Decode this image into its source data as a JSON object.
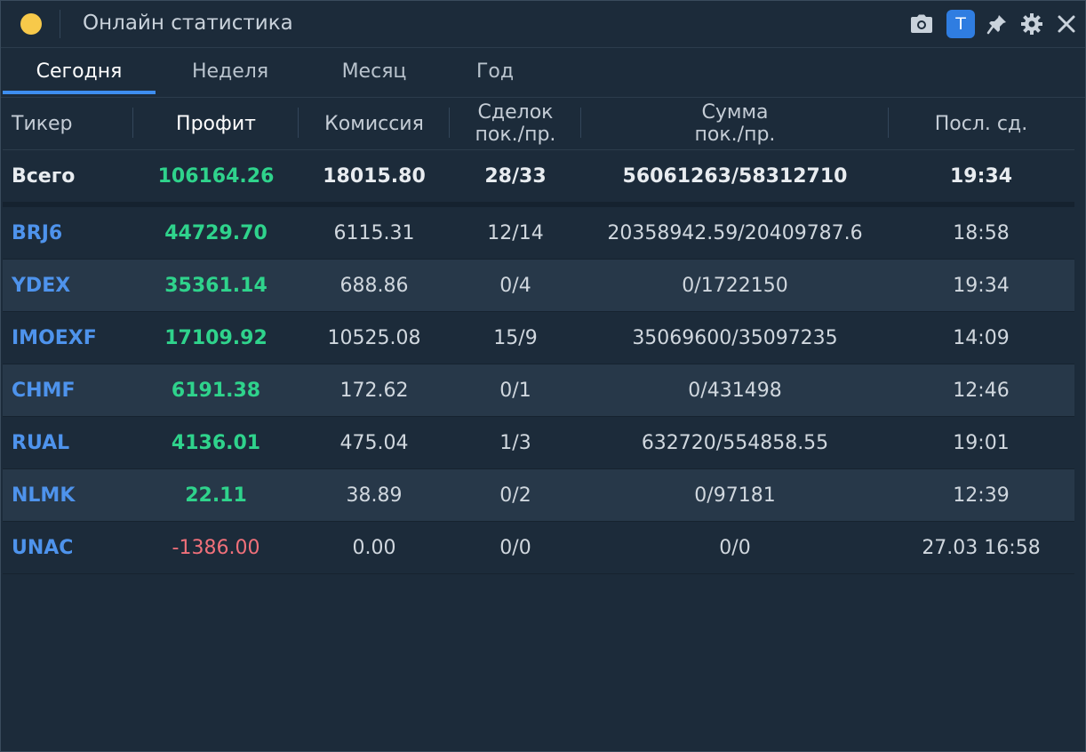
{
  "window": {
    "title": "Онлайн статистика",
    "theme_button_label": "T"
  },
  "colors": {
    "profit_positive": "#2fd38c",
    "profit_negative": "#f0707a",
    "ticker": "#4e93ec",
    "accent": "#3e8ef0",
    "status_dot": "#f7c94a"
  },
  "icons": [
    "camera-icon",
    "theme-toggle-icon",
    "pin-icon",
    "settings-gear-icon",
    "close-icon"
  ],
  "tabs": [
    {
      "label": "Сегодня",
      "active": true
    },
    {
      "label": "Неделя",
      "active": false
    },
    {
      "label": "Месяц",
      "active": false
    },
    {
      "label": "Год",
      "active": false
    }
  ],
  "table": {
    "headers": {
      "ticker": "Тикер",
      "profit": "Профит",
      "commission": "Комиссия",
      "deals_line1": "Сделок",
      "deals_line2": "пок./пр.",
      "sum_line1": "Сумма",
      "sum_line2": "пок./пр.",
      "last": "Посл. сд."
    },
    "total": {
      "label": "Всего",
      "profit": "106164.26",
      "commission": "18015.80",
      "deals": "28/33",
      "sum": "56061263/58312710",
      "last": "19:34"
    },
    "rows": [
      {
        "ticker": "BRJ6",
        "profit": "44729.70",
        "commission": "6115.31",
        "deals": "12/14",
        "sum": "20358942.59/20409787.6",
        "last": "18:58"
      },
      {
        "ticker": "YDEX",
        "profit": "35361.14",
        "commission": "688.86",
        "deals": "0/4",
        "sum": "0/1722150",
        "last": "19:34"
      },
      {
        "ticker": "IMOEXF",
        "profit": "17109.92",
        "commission": "10525.08",
        "deals": "15/9",
        "sum": "35069600/35097235",
        "last": "14:09"
      },
      {
        "ticker": "CHMF",
        "profit": "6191.38",
        "commission": "172.62",
        "deals": "0/1",
        "sum": "0/431498",
        "last": "12:46"
      },
      {
        "ticker": "RUAL",
        "profit": "4136.01",
        "commission": "475.04",
        "deals": "1/3",
        "sum": "632720/554858.55",
        "last": "19:01"
      },
      {
        "ticker": "NLMK",
        "profit": "22.11",
        "commission": "38.89",
        "deals": "0/2",
        "sum": "0/97181",
        "last": "12:39"
      },
      {
        "ticker": "UNAC",
        "profit": "-1386.00",
        "commission": "0.00",
        "deals": "0/0",
        "sum": "0/0",
        "last": "27.03 16:58"
      }
    ]
  }
}
